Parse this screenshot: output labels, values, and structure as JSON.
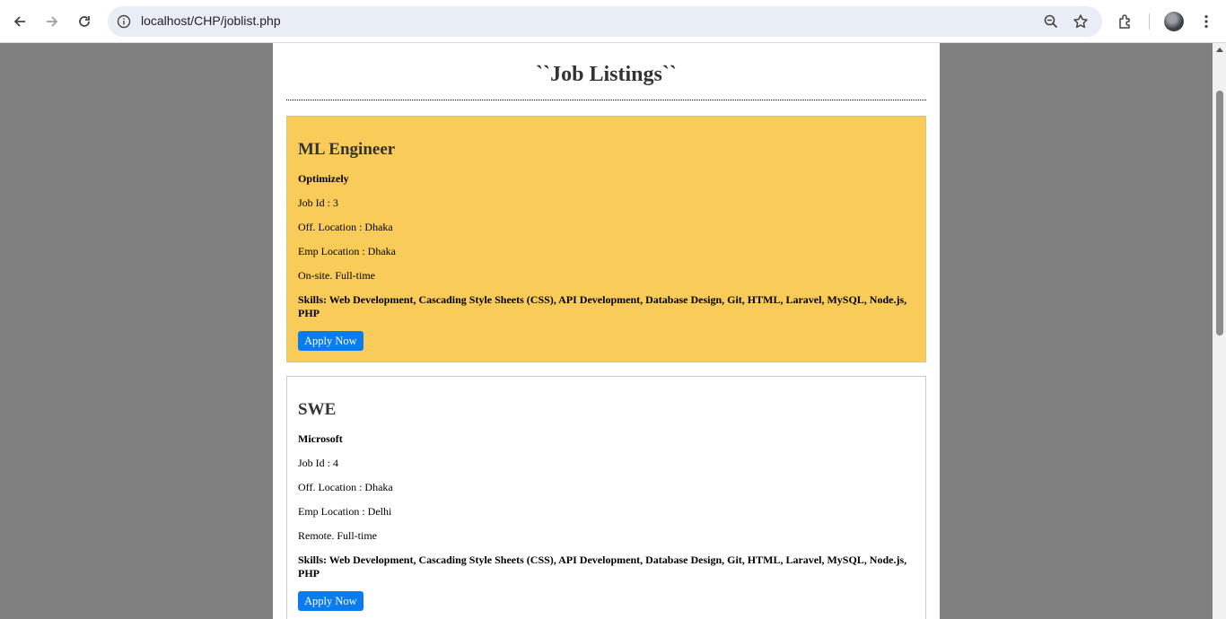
{
  "browser": {
    "url": "localhost/CHP/joblist.php",
    "icons": [
      "back-icon",
      "forward-icon",
      "reload-icon",
      "site-info-icon",
      "zoom-icon",
      "bookmark-star-icon",
      "extensions-icon",
      "profile-avatar",
      "more-menu-icon"
    ]
  },
  "page": {
    "title": "``Job Listings``"
  },
  "jobs": [
    {
      "title": "ML Engineer",
      "company": "Optimizely",
      "job_id": "Job Id : 3",
      "office_location": "Off. Location : Dhaka",
      "emp_location": "Emp Location : Dhaka",
      "work_type": "On-site. Full-time",
      "skills": "Skills: Web Development, Cascading Style Sheets (CSS), API Development, Database Design, Git, HTML, Laravel, MySQL, Node.js, PHP",
      "apply_label": "Apply Now",
      "background": "#f9cc5a"
    },
    {
      "title": "SWE",
      "company": "Microsoft",
      "job_id": "Job Id : 4",
      "office_location": "Off. Location : Dhaka",
      "emp_location": "Emp Location : Delhi",
      "work_type": "Remote. Full-time",
      "skills": "Skills: Web Development, Cascading Style Sheets (CSS), API Development, Database Design, Git, HTML, Laravel, MySQL, Node.js, PHP",
      "apply_label": "Apply Now",
      "background": "#ffffff"
    }
  ],
  "colors": {
    "apply_button": "#0a7cf0",
    "page_background": "#808080",
    "highlight_card": "#f9cc5a"
  }
}
